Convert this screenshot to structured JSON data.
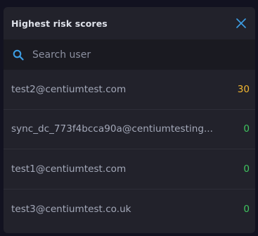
{
  "panel": {
    "title": "Highest risk scores",
    "close_icon": "close-icon"
  },
  "search": {
    "icon": "search-icon",
    "placeholder": "Search user",
    "value": ""
  },
  "colors": {
    "accent": "#3d9fe6",
    "score_high": "#f2b731",
    "score_low": "#3fc55f"
  },
  "users": [
    {
      "email": "test2@centiumtest.com",
      "score": "30",
      "level": "high"
    },
    {
      "email": "sync_dc_773f4bcca90a@centiumtesting...",
      "score": "0",
      "level": "low"
    },
    {
      "email": "test1@centiumtest.com",
      "score": "0",
      "level": "low"
    },
    {
      "email": "test3@centiumtest.co.uk",
      "score": "0",
      "level": "low"
    }
  ]
}
